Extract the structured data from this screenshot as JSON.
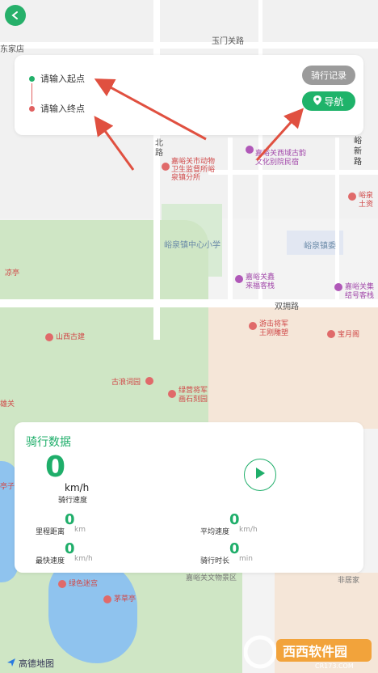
{
  "map": {
    "labels": {
      "road_top": "玉门关路",
      "road_mid": "双拥路",
      "bei": "北",
      "lu": "路",
      "poi_health_1": "嘉峪关市动物",
      "poi_health_2": "卫生监督所峪",
      "poi_health_3": "泉镇分所",
      "poi_culture_1": "嘉峪关西域古韵",
      "poi_culture_2": "文化别院民宿",
      "poi_school": "峪泉镇中心小学",
      "poi_town": "峪泉镇委",
      "poi_inn_1": "嘉峪关鑫",
      "poi_inn_2": "来福客栈",
      "poi_inn2_1": "嘉峪关集",
      "poi_inn2_2": "结号客栈",
      "poi_youji_1": "游击将军",
      "poi_youji_2": "王刚雕塑",
      "poi_baoyue": "宝月阁",
      "poi_shanxi": "山西古建",
      "poi_guci": "古浪词园",
      "poi_lv_1": "绿营将军",
      "poi_lv_2": "画石刻园",
      "poi_lvmigong": "绿色迷宫",
      "poi_maocao": "茅草亭",
      "poi_xinxin_1": "峪",
      "poi_xinxin_2": "新",
      "poi_xinxin_3": "路",
      "poi_right_1": "峪泉",
      "poi_right_2": "土资",
      "poi_jiafang": "东家店",
      "poi_liangting": "凉亭",
      "poi_jiguan": "雄关",
      "poi_ting": "亭子",
      "poi_bottom_road": "嘉峪关文物景区",
      "poi_bottom_right": "非居家"
    }
  },
  "back": {
    "icon": "chevron-left-icon"
  },
  "route": {
    "start_placeholder": "请输入起点",
    "end_placeholder": "请输入终点",
    "history_label": "骑行记录",
    "nav_label": "导航",
    "start_dot_color": "#22b06a",
    "end_dot_color": "#e06060"
  },
  "ride": {
    "title": "骑行数据",
    "speed_value": "0",
    "speed_unit": "km/h",
    "speed_label": "骑行速度",
    "distance_label": "里程距离",
    "distance_value": "0",
    "distance_unit": "km",
    "avg_label": "平均速度",
    "avg_value": "0",
    "avg_unit": "km/h",
    "max_label": "最快速度",
    "max_value": "0",
    "max_unit": "km/h",
    "time_label": "骑行时长",
    "time_value": "0",
    "time_unit": "min",
    "accent_color": "#1fae6a"
  },
  "brand": {
    "map_provider": "高德地图"
  },
  "watermark": {
    "main": "西西软件园",
    "sub": "CR173.COM"
  }
}
